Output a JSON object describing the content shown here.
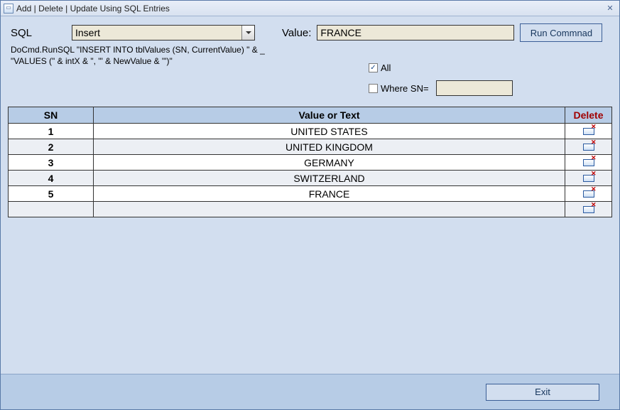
{
  "window": {
    "title": "Add | Delete | Update Using SQL Entries"
  },
  "form": {
    "sql_label": "SQL",
    "sql_combo_value": "Insert",
    "value_label": "Value:",
    "value_input": "FRANCE",
    "run_button": "Run Commnad",
    "code_line1": "DoCmd.RunSQL \"INSERT INTO tblValues (SN, CurrentValue) \" & _",
    "code_line2": "\"VALUES (\" & intX & \", '\" & NewValue & \"')\"",
    "all_checkbox_label": "All",
    "all_checked": true,
    "where_checkbox_label": "Where SN=",
    "where_checked": false,
    "where_value": ""
  },
  "grid": {
    "headers": {
      "sn": "SN",
      "value": "Value or Text",
      "delete": "Delete"
    },
    "rows": [
      {
        "sn": "1",
        "value": "UNITED STATES"
      },
      {
        "sn": "2",
        "value": "UNITED KINGDOM"
      },
      {
        "sn": "3",
        "value": "GERMANY"
      },
      {
        "sn": "4",
        "value": "SWITZERLAND"
      },
      {
        "sn": "5",
        "value": "FRANCE"
      },
      {
        "sn": "",
        "value": ""
      }
    ]
  },
  "footer": {
    "exit_button": "Exit"
  }
}
